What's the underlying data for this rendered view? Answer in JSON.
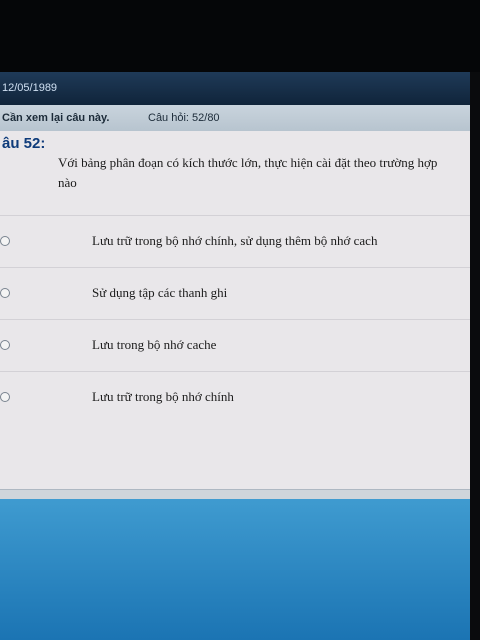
{
  "header": {
    "date": "12/05/1989"
  },
  "toolbar": {
    "review_label": "Cần xem lại câu này.",
    "counter": "Câu hỏi: 52/80"
  },
  "question": {
    "title": "âu 52:",
    "text": "Với bảng phân đoạn có kích thước lớn, thực hiện cài đặt theo trường hợp nào"
  },
  "options": [
    {
      "label": "Lưu trữ trong bộ nhớ chính, sử dụng thêm bộ nhớ cach"
    },
    {
      "label": "Sử dụng tập các thanh ghi"
    },
    {
      "label": "Lưu trong bộ nhớ cache"
    },
    {
      "label": "Lưu trữ trong bộ nhớ chính"
    }
  ]
}
